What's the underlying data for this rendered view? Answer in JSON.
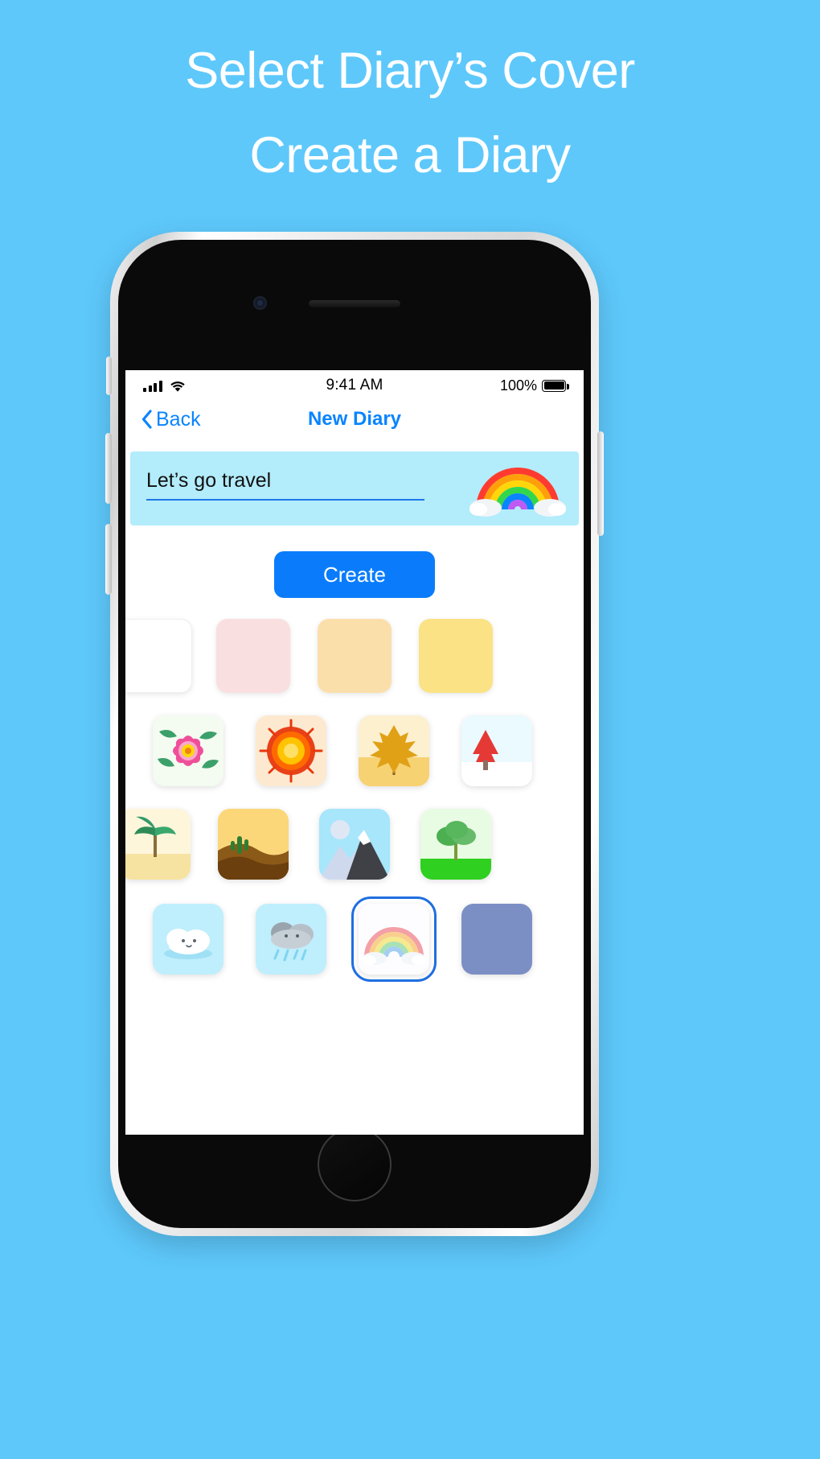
{
  "promo": {
    "line1": "Select Diary’s Cover",
    "line2": "Create a Diary",
    "background_color": "#5ec8fb",
    "text_color": "#ffffff"
  },
  "status_bar": {
    "signal_icon": "cellular-bars-icon",
    "wifi_icon": "wifi-icon",
    "time": "9:41 AM",
    "battery_percent": "100%",
    "battery_icon": "battery-full-icon"
  },
  "nav_bar": {
    "back_label": "Back",
    "back_icon": "chevron-left-icon",
    "title": "New Diary",
    "tint_color": "#0a84ff"
  },
  "form": {
    "title_value": "Let’s go travel",
    "title_placeholder": "Diary title",
    "card_color": "#b3ecfb",
    "underline_color": "#1e78e8",
    "preview_icon": "rainbow-icon",
    "create_label": "Create",
    "create_color": "#0a7cfb"
  },
  "covers": {
    "color_row": [
      {
        "name": "white",
        "color": "#ffffff"
      },
      {
        "name": "pink",
        "color": "#fadfe0"
      },
      {
        "name": "peach",
        "color": "#fbdfab"
      },
      {
        "name": "yellow",
        "color": "#fbe284"
      }
    ],
    "row_seasons": [
      {
        "name": "flower",
        "label": "spring-flower-icon"
      },
      {
        "name": "sun",
        "label": "summer-sun-icon"
      },
      {
        "name": "maple-leaf",
        "label": "autumn-leaf-icon"
      },
      {
        "name": "snow-tree",
        "label": "winter-tree-icon"
      }
    ],
    "row_places": [
      {
        "name": "palm-beach",
        "label": "beach-palm-icon"
      },
      {
        "name": "desert",
        "label": "desert-cactus-icon"
      },
      {
        "name": "mountain",
        "label": "mountain-icon"
      },
      {
        "name": "tree-field",
        "label": "tree-field-icon"
      }
    ],
    "row_weather": [
      {
        "name": "cloud",
        "label": "cloud-icon"
      },
      {
        "name": "rain-cloud",
        "label": "rain-cloud-icon"
      },
      {
        "name": "rainbow",
        "label": "rainbow-icon",
        "selected": true
      },
      {
        "name": "night",
        "label": "night-icon"
      }
    ],
    "selected_cover": "rainbow",
    "selection_border_color": "#1f6fe0"
  }
}
